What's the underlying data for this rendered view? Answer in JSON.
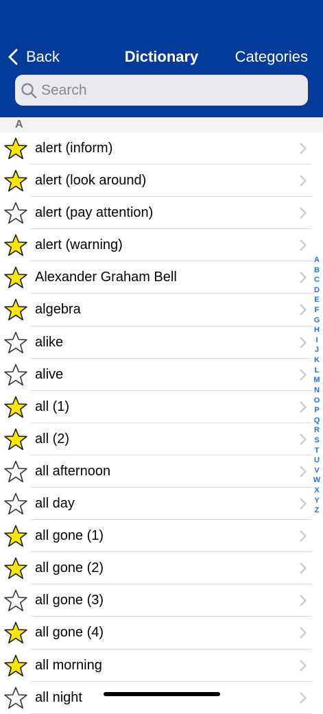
{
  "nav": {
    "back_label": "Back",
    "title": "Dictionary",
    "categories_label": "Categories"
  },
  "search": {
    "placeholder": "Search"
  },
  "section": {
    "letter": "A"
  },
  "entries": [
    {
      "label": "alert (inform)",
      "favorite": true
    },
    {
      "label": "alert (look around)",
      "favorite": true
    },
    {
      "label": "alert (pay attention)",
      "favorite": false
    },
    {
      "label": "alert (warning)",
      "favorite": true
    },
    {
      "label": "Alexander Graham Bell",
      "favorite": true
    },
    {
      "label": "algebra",
      "favorite": true
    },
    {
      "label": "alike",
      "favorite": false
    },
    {
      "label": "alive",
      "favorite": false
    },
    {
      "label": "all (1)",
      "favorite": true
    },
    {
      "label": "all (2)",
      "favorite": true
    },
    {
      "label": "all afternoon",
      "favorite": false
    },
    {
      "label": "all day",
      "favorite": false
    },
    {
      "label": "all gone (1)",
      "favorite": true
    },
    {
      "label": "all gone (2)",
      "favorite": true
    },
    {
      "label": "all gone (3)",
      "favorite": false
    },
    {
      "label": "all gone (4)",
      "favorite": true
    },
    {
      "label": "all morning",
      "favorite": true
    },
    {
      "label": "all night",
      "favorite": false
    }
  ],
  "index_letters": [
    "A",
    "B",
    "C",
    "D",
    "E",
    "F",
    "G",
    "H",
    "I",
    "J",
    "K",
    "L",
    "M",
    "N",
    "O",
    "P",
    "Q",
    "R",
    "S",
    "T",
    "U",
    "V",
    "W",
    "X",
    "Y",
    "Z"
  ],
  "colors": {
    "header": "#033b9a",
    "star_filled": "#ffe600",
    "index_text": "#1a73e8"
  },
  "icons": {
    "back": "chevron-left-icon",
    "search": "magnifier-icon",
    "favorite_on": "star-filled-icon",
    "favorite_off": "star-outline-icon",
    "disclosure": "chevron-right-icon"
  }
}
